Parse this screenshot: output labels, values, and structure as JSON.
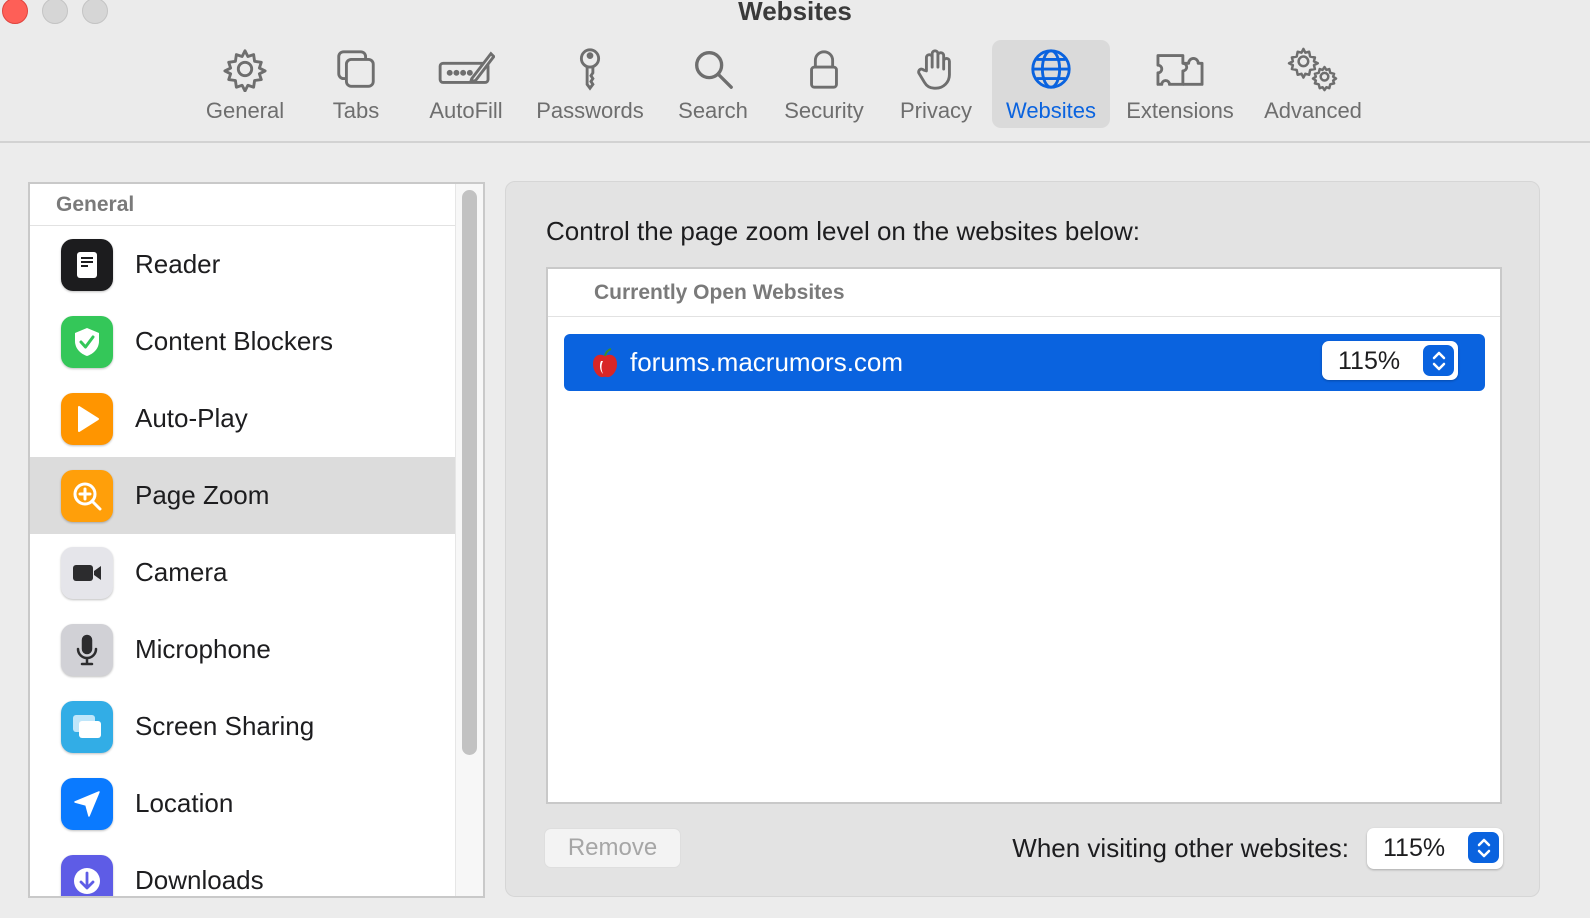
{
  "window": {
    "title": "Websites"
  },
  "toolbar": {
    "items": [
      {
        "label": "General",
        "icon": "gear-icon"
      },
      {
        "label": "Tabs",
        "icon": "tabs-icon"
      },
      {
        "label": "AutoFill",
        "icon": "autofill-icon"
      },
      {
        "label": "Passwords",
        "icon": "key-icon"
      },
      {
        "label": "Search",
        "icon": "magnifier-icon"
      },
      {
        "label": "Security",
        "icon": "lock-icon"
      },
      {
        "label": "Privacy",
        "icon": "hand-icon"
      },
      {
        "label": "Websites",
        "icon": "globe-icon",
        "active": true
      },
      {
        "label": "Extensions",
        "icon": "puzzle-icon"
      },
      {
        "label": "Advanced",
        "icon": "gears-icon"
      }
    ],
    "accent": "#0a63df"
  },
  "sidebar": {
    "header": "General",
    "items": [
      {
        "label": "Reader",
        "icon": "reader-icon",
        "color": "#1c1c1e"
      },
      {
        "label": "Content Blockers",
        "icon": "shield-check-icon",
        "color": "#34c759"
      },
      {
        "label": "Auto-Play",
        "icon": "play-icon",
        "color": "#ff9500"
      },
      {
        "label": "Page Zoom",
        "icon": "zoom-icon",
        "color": "#ff9f0a",
        "selected": true
      },
      {
        "label": "Camera",
        "icon": "camera-icon",
        "color": "#636366"
      },
      {
        "label": "Microphone",
        "icon": "microphone-icon",
        "color": "#aeaeb2"
      },
      {
        "label": "Screen Sharing",
        "icon": "screen-sharing-icon",
        "color": "#32ade6"
      },
      {
        "label": "Location",
        "icon": "location-arrow-icon",
        "color": "#0a7aff"
      },
      {
        "label": "Downloads",
        "icon": "download-icon",
        "color": "#5e5ce6"
      }
    ]
  },
  "main": {
    "instruction": "Control the page zoom level on the websites below:",
    "table_header": "Currently Open Websites",
    "sites": [
      {
        "domain": "forums.macrumors.com",
        "zoom": "115%",
        "favicon": "macrumors-apple-icon"
      }
    ],
    "remove_label": "Remove",
    "other_label": "When visiting other websites:",
    "other_zoom": "115%"
  }
}
